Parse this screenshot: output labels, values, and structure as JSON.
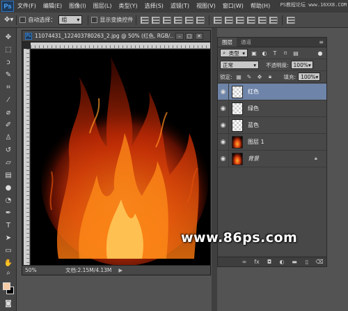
{
  "menubar": {
    "logo": "Ps",
    "items": [
      "文件(F)",
      "编辑(E)",
      "图像(I)",
      "图层(L)",
      "类型(Y)",
      "选择(S)",
      "滤镜(T)",
      "视图(V)",
      "窗口(W)",
      "帮助(H)"
    ],
    "watermark": "PS教程论坛 www.16XX8.COM"
  },
  "options": {
    "auto_select_label": "自动选择：",
    "auto_select_value": "组",
    "show_transform_label": "显示变换控件"
  },
  "document": {
    "title": "11074431_122403780263_2.jpg @ 50% (红色, RGB/...",
    "zoom": "50%",
    "doc_size": "文档:2.15M/4.13M",
    "status_arrow": "▶"
  },
  "layers_panel": {
    "tabs": [
      "图层",
      "通道"
    ],
    "filter_kind": "类型",
    "blend_mode": "正常",
    "opacity_label": "不透明度:",
    "opacity_value": "100%",
    "lock_label": "锁定:",
    "fill_label": "填充:",
    "fill_value": "100%",
    "layers": [
      {
        "name": "红色",
        "thumb": "transparent",
        "selected": true
      },
      {
        "name": "绿色",
        "thumb": "transparent",
        "selected": false
      },
      {
        "name": "蓝色",
        "thumb": "transparent",
        "selected": false
      },
      {
        "name": "图层 1",
        "thumb": "fire",
        "selected": false
      },
      {
        "name": "背景",
        "thumb": "fire",
        "selected": false,
        "locked": true,
        "italic": true
      }
    ]
  },
  "website_watermark": "www.86ps.com",
  "colors": {
    "foreground": "#f7cba5",
    "background": "#000000",
    "selected_layer": "#6e84a8"
  }
}
